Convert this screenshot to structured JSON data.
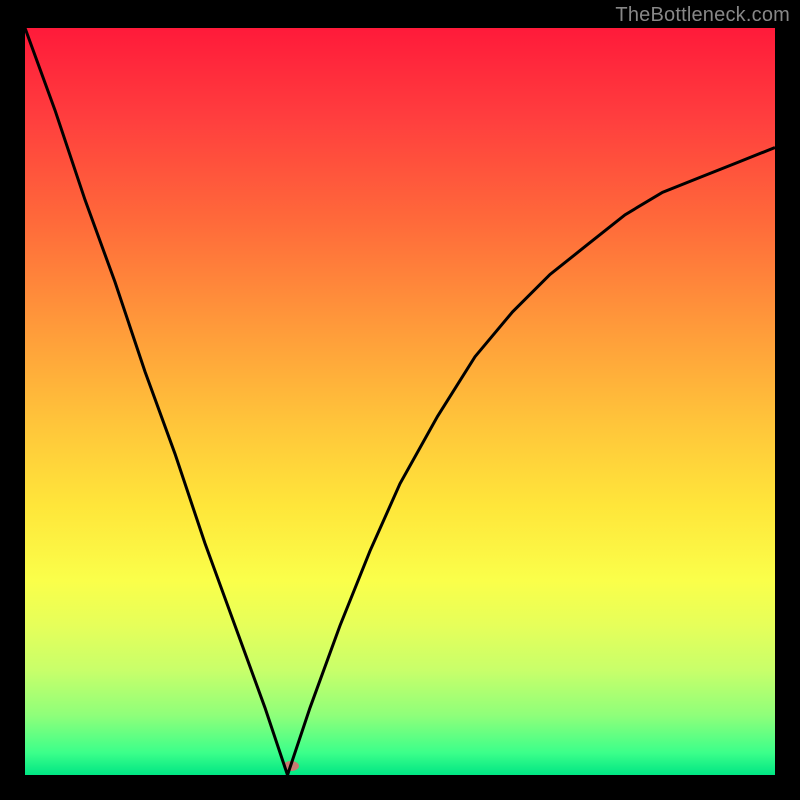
{
  "watermark": "TheBottleneck.com",
  "colors": {
    "frame_bg": "#000000",
    "curve_stroke": "#000000",
    "blob_fill": "#c77b72",
    "gradient_stops": [
      "#ff1a3a",
      "#ff3e3e",
      "#ff6a3a",
      "#ff9a3a",
      "#ffc53a",
      "#ffe63a",
      "#faff4a",
      "#e6ff5a",
      "#c8ff6a",
      "#8fff7a",
      "#3cff8a",
      "#00e684"
    ]
  },
  "chart_data": {
    "type": "line",
    "title": "",
    "xlabel": "",
    "ylabel": "",
    "xlim": [
      0,
      100
    ],
    "ylim": [
      0,
      100
    ],
    "grid": false,
    "legend": false,
    "annotations": [],
    "notch_x": 35,
    "blob": {
      "x": 35.5,
      "y": 1.2
    },
    "series": [
      {
        "name": "curve",
        "x": [
          0,
          4,
          8,
          12,
          16,
          20,
          24,
          28,
          32,
          35,
          38,
          42,
          46,
          50,
          55,
          60,
          65,
          70,
          75,
          80,
          85,
          90,
          95,
          100
        ],
        "y": [
          100,
          89,
          77,
          66,
          54,
          43,
          31,
          20,
          9,
          0,
          9,
          20,
          30,
          39,
          48,
          56,
          62,
          67,
          71,
          75,
          78,
          80,
          82,
          84
        ]
      }
    ]
  }
}
